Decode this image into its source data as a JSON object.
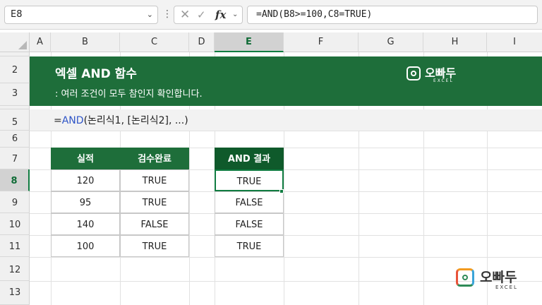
{
  "formula_bar": {
    "name_box": "E8",
    "formula": "=AND(B8>=100,C8=TRUE)"
  },
  "icons": {
    "name_box_dropdown": "chevron-down-icon",
    "more": "vertical-ellipsis-icon",
    "cancel": "close-icon",
    "enter": "check-icon",
    "insert_function": "function-icon",
    "expand": "chevron-down-icon"
  },
  "columns": [
    "A",
    "B",
    "C",
    "D",
    "E",
    "F",
    "G",
    "H",
    "I"
  ],
  "rows": [
    "1",
    "2",
    "3",
    "4",
    "5",
    "6",
    "7",
    "8",
    "9",
    "10",
    "11",
    "12",
    "13"
  ],
  "selected": {
    "column": "E",
    "row": "8"
  },
  "banner": {
    "title": "엑셀 AND 함수",
    "subtitle": ": 여러 조건이 모두 참인지 확인합니다."
  },
  "syntax": {
    "prefix": "=",
    "fn": "AND",
    "args": "(논리식1, [논리식2], ...)"
  },
  "data_table": {
    "headers": [
      "실적",
      "검수완료"
    ],
    "rows": [
      [
        "120",
        "TRUE"
      ],
      [
        "95",
        "TRUE"
      ],
      [
        "140",
        "FALSE"
      ],
      [
        "100",
        "TRUE"
      ]
    ]
  },
  "result_table": {
    "header": "AND 결과",
    "values": [
      "TRUE",
      "FALSE",
      "FALSE",
      "TRUE"
    ]
  },
  "logo": {
    "name": "오빠두",
    "sub": "EXCEL"
  },
  "colors": {
    "banner_green": "#1e6e3a",
    "header_green": "#1e6e3a",
    "selection_green": "#107c41",
    "function_blue": "#2f55c7"
  }
}
